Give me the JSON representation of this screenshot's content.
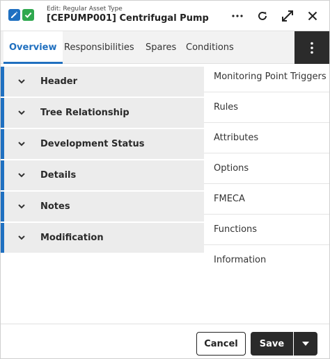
{
  "titlebar": {
    "subtitle": "Edit: Regular Asset Type",
    "title": "[CEPUMP001] Centrifugal Pump",
    "icons": [
      "edit-pencil-icon",
      "checkmark-icon"
    ],
    "actions": [
      "more-horizontal-icon",
      "refresh-icon",
      "expand-icon",
      "close-icon"
    ]
  },
  "tabs": [
    {
      "label": "Overview",
      "active": true
    },
    {
      "label": "Responsibilities",
      "active": false
    },
    {
      "label": "Spares",
      "active": false
    },
    {
      "label": "Conditions",
      "active": false
    }
  ],
  "sections": [
    {
      "label": "Header"
    },
    {
      "label": "Tree Relationship"
    },
    {
      "label": "Development Status"
    },
    {
      "label": "Details"
    },
    {
      "label": "Notes"
    },
    {
      "label": "Modification"
    }
  ],
  "navlist": [
    {
      "label": "Monitoring Point Triggers"
    },
    {
      "label": "Rules"
    },
    {
      "label": "Attributes"
    },
    {
      "label": "Options"
    },
    {
      "label": "FMECA"
    },
    {
      "label": "Functions"
    },
    {
      "label": "Information"
    }
  ],
  "footer": {
    "cancel_label": "Cancel",
    "save_label": "Save"
  },
  "colors": {
    "accent": "#1f70c1",
    "check": "#2fa84f",
    "dark": "#2a2a2a"
  }
}
